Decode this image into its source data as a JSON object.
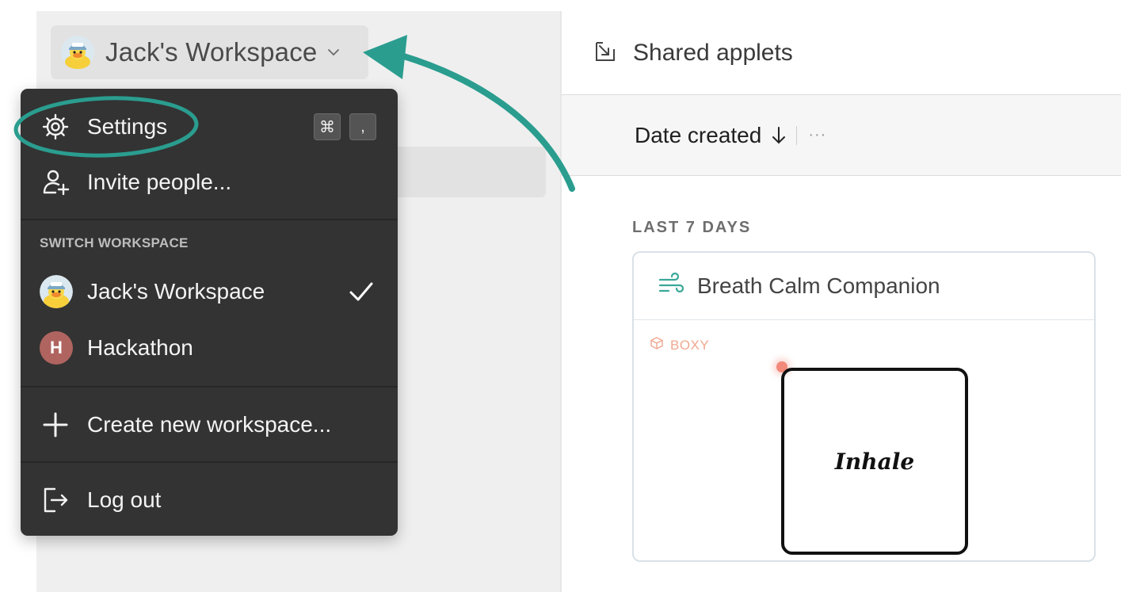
{
  "sidebar": {
    "workspace_switcher": {
      "name": "Jack's Workspace"
    }
  },
  "main": {
    "header_title": "Shared applets",
    "sort": {
      "label": "Date created",
      "more": "···"
    },
    "section_label": "LAST 7 DAYS",
    "card": {
      "title": "Breath Calm Companion",
      "tag": "BOXY",
      "breath_word": "Inhale"
    }
  },
  "menu": {
    "settings": {
      "label": "Settings",
      "shortcut_cmd": "⌘",
      "shortcut_key": ","
    },
    "invite": {
      "label": "Invite people..."
    },
    "switch_section": "SWITCH WORKSPACE",
    "workspaces": [
      {
        "name": "Jack's Workspace",
        "selected": true
      },
      {
        "name": "Hackathon",
        "initial": "H",
        "selected": false
      }
    ],
    "create": {
      "label": "Create new workspace..."
    },
    "logout": {
      "label": "Log out"
    }
  },
  "colors": {
    "accent_annotation": "#2a9d8f",
    "menu_bg": "#333333",
    "hackathon_avatar": "#b06460",
    "boxy_tag": "#f0a890",
    "card_icon": "#3aa89a"
  },
  "icons": [
    "duck-avatar-icon",
    "chevron-down-icon",
    "shared-applets-icon",
    "arrow-down-icon",
    "wind-icon",
    "cube-icon",
    "gear-icon",
    "add-user-icon",
    "checkmark-icon",
    "plus-icon",
    "logout-icon"
  ]
}
